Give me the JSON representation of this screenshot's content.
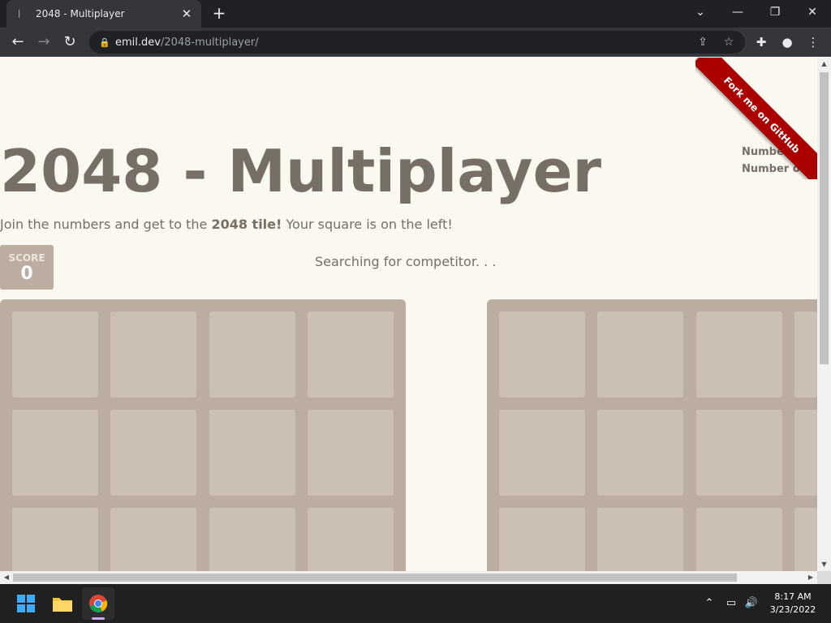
{
  "browser": {
    "tab_title": "2048 - Multiplayer",
    "url_host": "emil.dev",
    "url_path": "/2048-multiplayer/"
  },
  "page": {
    "heading": "2048 - Multiplayer",
    "intro_before": "Join the numbers and get to the ",
    "intro_bold": "2048 tile!",
    "intro_after": " Your square is on the left!",
    "score_label": "SCORE",
    "score_value": "0",
    "status": "Searching for competitor. . .",
    "side_line1": "Number of",
    "side_line2": "Number of cu",
    "ribbon": "Fork me on GitHub"
  },
  "taskbar": {
    "time": "8:17 AM",
    "date": "3/23/2022"
  },
  "colors": {
    "page_bg": "#faf8ef",
    "text": "#776e65",
    "board": "#bbada0",
    "ribbon": "#aa0000"
  },
  "icons": {
    "tab_favicon": "2048-favicon",
    "lock": "lock-icon",
    "share": "share-icon",
    "star": "star-icon",
    "extensions": "puzzle-icon",
    "profile": "profile-icon",
    "menu": "kebab-menu-icon"
  }
}
